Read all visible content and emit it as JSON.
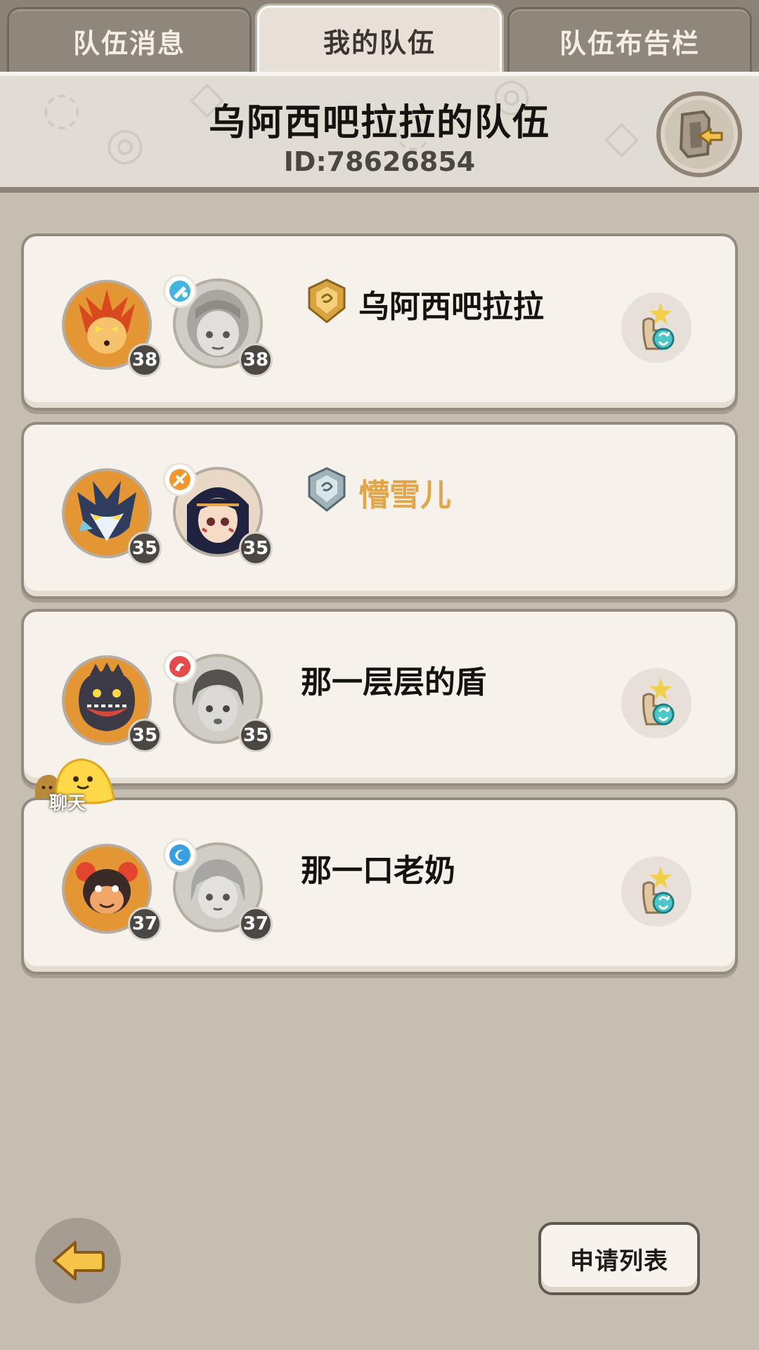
{
  "tabs": [
    {
      "label": "队伍消息",
      "active": false
    },
    {
      "label": "我的队伍",
      "active": true
    },
    {
      "label": "队伍布告栏",
      "active": false
    }
  ],
  "team": {
    "title": "乌阿西吧拉拉的队伍",
    "id_text": "ID:78626854"
  },
  "members": [
    {
      "name": "乌阿西吧拉拉",
      "pet_level": "38",
      "hero_level": "38",
      "rank_icon": "gold-shield-icon",
      "role_icon": "blue-role-icon",
      "name_color": "#151311",
      "has_like_button": true
    },
    {
      "name": "懵雪儿",
      "pet_level": "35",
      "hero_level": "35",
      "rank_icon": "silver-shield-icon",
      "role_icon": "orange-role-icon",
      "name_color": "#e2a64a",
      "has_like_button": false
    },
    {
      "name": "那一层层的盾",
      "pet_level": "35",
      "hero_level": "35",
      "rank_icon": "",
      "role_icon": "red-role-icon",
      "name_color": "#151311",
      "has_like_button": true
    },
    {
      "name": "那一口老奶",
      "pet_level": "37",
      "hero_level": "37",
      "rank_icon": "",
      "role_icon": "blue-swirl-role-icon",
      "name_color": "#151311",
      "has_like_button": true
    }
  ],
  "chat": {
    "label": "聊天"
  },
  "footer": {
    "apply_list_label": "申请列表"
  },
  "colors": {
    "background": "#c6beb1",
    "card": "#f6f1ea",
    "highlight_name": "#e2a64a",
    "accent_blue": "#3ab4d8"
  }
}
